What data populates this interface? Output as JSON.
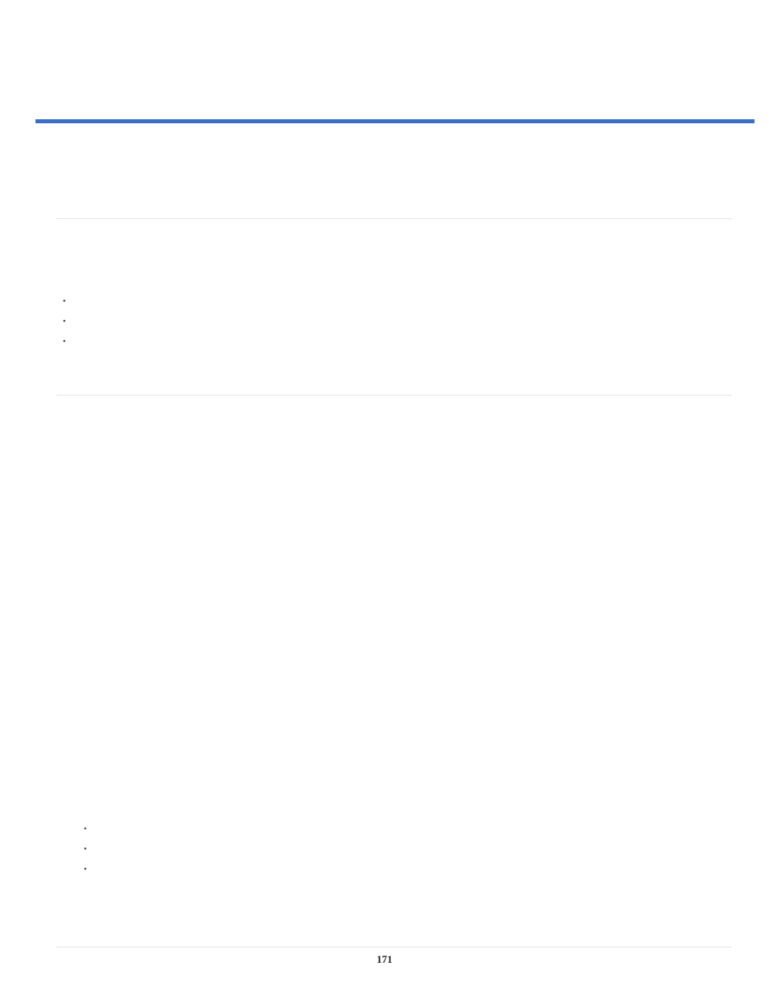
{
  "page_number": "171",
  "bullets_group_1": [
    "",
    "",
    ""
  ],
  "bullets_group_2": [
    "",
    "",
    ""
  ]
}
